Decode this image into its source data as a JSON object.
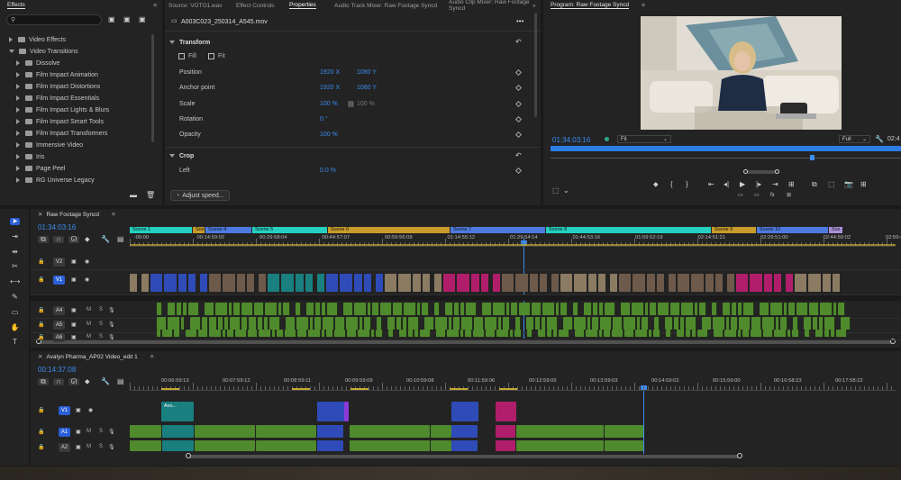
{
  "colors": {
    "accent": "#3b8cf0",
    "audio": "#4f8a2c",
    "video_teal": "#197f7f",
    "video_blue": "#2f4bb8",
    "video_pink": "#b01e6b",
    "scene_teal": "#25d0c0",
    "scene_gold": "#c89b2a",
    "scene_blue": "#4d7ae0",
    "scene_lilac": "#a890d8"
  },
  "effects": {
    "tab": "Effects",
    "search_placeholder": "",
    "items": [
      {
        "label": "Video Effects",
        "open": false,
        "indent": 0
      },
      {
        "label": "Video Transitions",
        "open": true,
        "indent": 0
      },
      {
        "label": "Dissolve",
        "open": false,
        "indent": 1
      },
      {
        "label": "Film Impact Animation",
        "open": false,
        "indent": 1
      },
      {
        "label": "Film Impact Distortions",
        "open": false,
        "indent": 1
      },
      {
        "label": "Film Impact Essentials",
        "open": false,
        "indent": 1
      },
      {
        "label": "Film Impact Lights & Blurs",
        "open": false,
        "indent": 1
      },
      {
        "label": "Film Impact Smart Tools",
        "open": false,
        "indent": 1
      },
      {
        "label": "Film Impact Transformers",
        "open": false,
        "indent": 1
      },
      {
        "label": "Immersive Video",
        "open": false,
        "indent": 1
      },
      {
        "label": "Iris",
        "open": false,
        "indent": 1
      },
      {
        "label": "Page Peel",
        "open": false,
        "indent": 1
      },
      {
        "label": "RG Universe Legacy",
        "open": false,
        "indent": 1
      }
    ]
  },
  "center_tabs": [
    "Source: VOTO1.wav",
    "Effect Controls",
    "Properties",
    "Audio Track Mixer: Raw Footage Syncd",
    "Audio Clip Mixer: Raw Footage Syncd"
  ],
  "properties": {
    "clip_name": "A003C023_250314_A545.mov",
    "transform_label": "Transform",
    "fill_label": "Fill",
    "fit_label": "Fit",
    "rows": [
      {
        "label": "Position",
        "v1": "1920 X",
        "v2": "1080 Y"
      },
      {
        "label": "Anchor point",
        "v1": "1920 X",
        "v2": "1080 Y"
      },
      {
        "label": "Scale",
        "v1": "100 %",
        "v2": "100 %"
      },
      {
        "label": "Rotation",
        "v1": "0 °",
        "v2": ""
      },
      {
        "label": "Opacity",
        "v1": "100 %",
        "v2": ""
      }
    ],
    "crop_label": "Crop",
    "crop_rows": [
      {
        "label": "Left",
        "v1": "0.0 %"
      }
    ],
    "adjust_speed": "Adjust speed..."
  },
  "program": {
    "title": "Program: Raw Footage Syncd",
    "timecode": "01:34:03:16",
    "fit": "Fit",
    "quality": "Full",
    "right_timecode": "02:4"
  },
  "seq1": {
    "tab": "Raw Footage Syncd",
    "timecode": "01:34:03:16",
    "scenes": [
      "Scene 1",
      "Sce",
      "Scene 4",
      "Scene 5",
      "Scene 6",
      "Scene 7",
      "Scene 8",
      "Scene 9",
      "Scene 10",
      "Sce"
    ],
    "ruler": [
      ":00:00",
      "00:14:59:02",
      "00:29:58:04",
      "00:44:57:07",
      "00:59:56:09",
      "01:14:55:12",
      "01:29:54:14",
      "01:44:53:16",
      "01:59:52:19",
      "02:14:51:21",
      "02:29:51:00",
      "02:44:50:02",
      "02:59:4"
    ],
    "tracks": [
      "V2",
      "V1",
      "A4",
      "A5",
      "A6"
    ],
    "track_msm": [
      "M",
      "S"
    ]
  },
  "seq2": {
    "tab": "Avalyn Pharma_AP02 Video_edit 1",
    "timecode": "00:14:37:08",
    "ruler": [
      "00:06:59:13",
      "00:07:59:12",
      "00:08:59:11",
      "00:09:59:09",
      "00:10:59:08",
      "00:11:59:06",
      "00:12:59:05",
      "00:13:59:03",
      "00:14:59:02",
      "00:15:59:00",
      "00:16:58:23",
      "00:17:58:22"
    ],
    "tracks": [
      "V1",
      "A1",
      "A2"
    ],
    "clip_label": "Avo..."
  }
}
